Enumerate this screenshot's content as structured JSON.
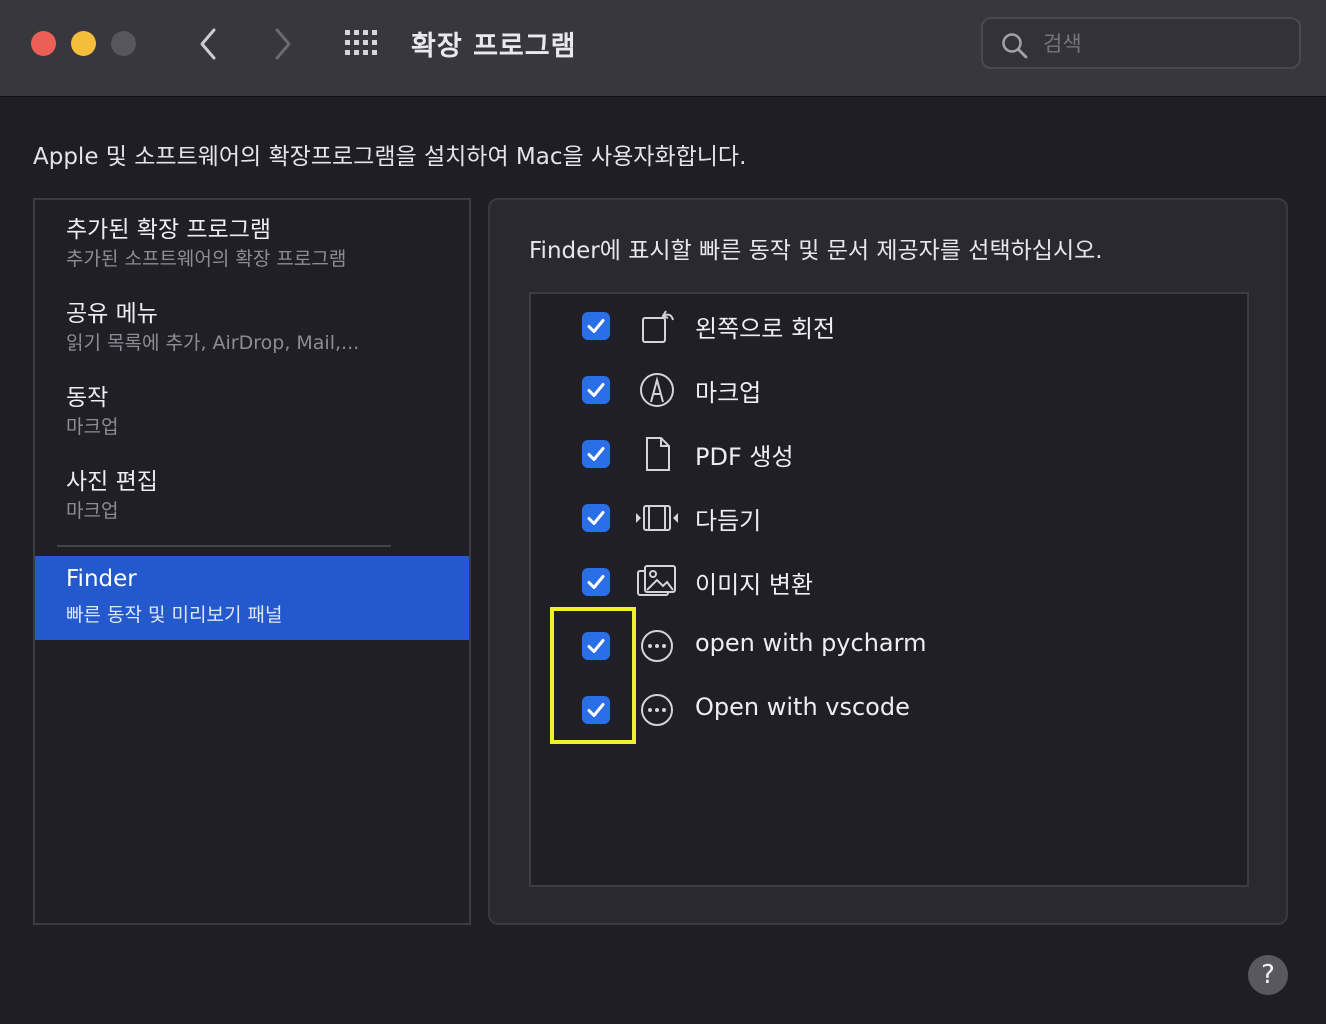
{
  "window": {
    "title": "확장 프로그램",
    "search_placeholder": "검색"
  },
  "description": "Apple 및 소프트웨어의 확장프로그램을 설치하여 Mac을 사용자화합니다.",
  "sidebar": {
    "items": [
      {
        "title": "추가된 확장 프로그램",
        "subtitle": "추가된 소프트웨어의 확장 프로그램"
      },
      {
        "title": "공유 메뉴",
        "subtitle": "읽기 목록에 추가, AirDrop, Mail,..."
      },
      {
        "title": "동작",
        "subtitle": "마크업"
      },
      {
        "title": "사진 편집",
        "subtitle": "마크업"
      },
      {
        "title": "Finder",
        "subtitle": "빠른 동작 및 미리보기 패널",
        "selected": true
      }
    ]
  },
  "panel": {
    "description": "Finder에 표시할 빠른 동작 및 문서 제공자를 선택하십시오.",
    "extensions": [
      {
        "label": "왼쪽으로 회전",
        "checked": true,
        "icon": "rotate-left-icon"
      },
      {
        "label": "마크업",
        "checked": true,
        "icon": "markup-icon"
      },
      {
        "label": "PDF 생성",
        "checked": true,
        "icon": "document-icon"
      },
      {
        "label": "다듬기",
        "checked": true,
        "icon": "trim-icon"
      },
      {
        "label": "이미지 변환",
        "checked": true,
        "icon": "photos-icon"
      },
      {
        "label": "open with pycharm",
        "checked": true,
        "icon": "more-icon"
      },
      {
        "label": "Open with vscode",
        "checked": true,
        "icon": "more-icon"
      }
    ]
  },
  "help_label": "?",
  "colors": {
    "selection": "#2458cd",
    "checkbox": "#2b6fe6",
    "highlight": "#f1f030"
  }
}
